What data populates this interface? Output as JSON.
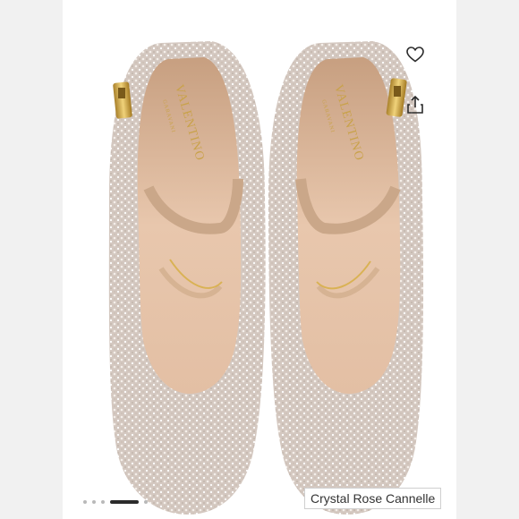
{
  "product": {
    "caption": "Crystal Rose Cannelle",
    "brand_logo_text": "VALENTINO",
    "brand_logo_subtext": "GARAVANI"
  },
  "actions": {
    "like_icon": "heart-outline-icon",
    "share_icon": "share-up-arrow-icon"
  },
  "gallery": {
    "total_images": 5,
    "active_index": 3
  },
  "colors": {
    "suede": "#d8b396",
    "inner": "#e7c6ac",
    "crystal": "#d9cfc8",
    "gold": "#c9a24a",
    "pager_active": "#2b2b2b",
    "pager_inactive": "#b9b9b9"
  }
}
